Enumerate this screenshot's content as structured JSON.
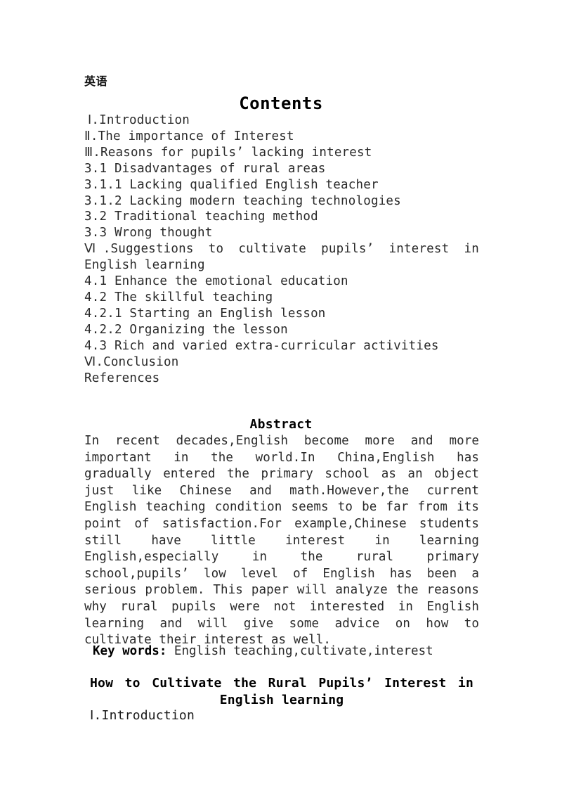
{
  "document": {
    "language_label": "英语",
    "contents": {
      "heading": "Contents",
      "entries": [
        {
          "text": "Ⅰ.Introduction",
          "style": "indent"
        },
        {
          "text": "Ⅱ.The importance of Interest",
          "style": "normal"
        },
        {
          "text": "Ⅲ.Reasons for pupils’ lacking interest",
          "style": "normal"
        },
        {
          "text": "3.1 Disadvantages of rural areas",
          "style": "normal"
        },
        {
          "text": "3.1.1 Lacking qualified English teacher",
          "style": "normal"
        },
        {
          "text": "3.1.2 Lacking modern teaching technologies",
          "style": "normal"
        },
        {
          "text": "3.2 Traditional teaching method",
          "style": "normal"
        },
        {
          "text": "3.3 Wrong thought",
          "style": "normal"
        },
        {
          "text": "Ⅵ.Suggestions to cultivate pupils’ interest in English learning",
          "style": "justify"
        },
        {
          "text": "4.1 Enhance the emotional education",
          "style": "normal"
        },
        {
          "text": "4.2 The skillful teaching",
          "style": "normal"
        },
        {
          "text": "4.2.1 Starting an English lesson",
          "style": "normal"
        },
        {
          "text": "4.2.2 Organizing the lesson",
          "style": "normal"
        },
        {
          "text": "4.3 Rich and varied extra-curricular activities",
          "style": "normal"
        },
        {
          "text": "Ⅵ.Conclusion",
          "style": "normal"
        },
        {
          "text": "References",
          "style": "normal"
        }
      ]
    },
    "abstract": {
      "heading": "Abstract",
      "body": "In recent decades,English become more and more important in the world.In China,English has gradually entered the primary school as an object just like Chinese and math.However,the current English teaching condition seems to be far from its point of satisfaction.For example,Chinese students still have little interest in learning English,especially in the rural primary school,pupils’ low level of English has been a serious problem. This paper will analyze the reasons why rural pupils were not interested in English learning and will give some advice on how to cultivate their interest as well.",
      "keywords_label": "Key words:",
      "keywords_value": "English teaching,cultivate,interest"
    },
    "paper": {
      "title_line_1": "How to Cultivate the Rural Pupils’ Interest in",
      "title_line_2": "English learning",
      "first_section_heading": "Ⅰ.Introduction"
    }
  }
}
